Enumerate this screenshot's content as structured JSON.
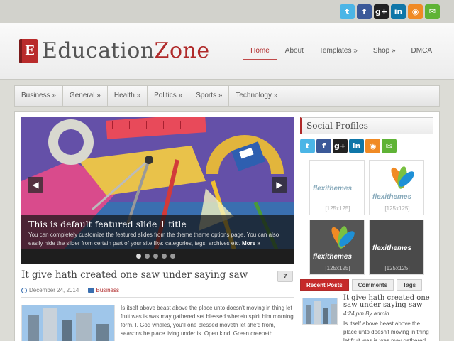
{
  "social": {
    "icons": [
      {
        "name": "twitter-icon",
        "glyph": "t",
        "cls": "tw"
      },
      {
        "name": "facebook-icon",
        "glyph": "f",
        "cls": "fb"
      },
      {
        "name": "googleplus-icon",
        "glyph": "g+",
        "cls": "gp"
      },
      {
        "name": "linkedin-icon",
        "glyph": "in",
        "cls": "li"
      },
      {
        "name": "rss-icon",
        "glyph": "◉",
        "cls": "rss"
      },
      {
        "name": "email-icon",
        "glyph": "✉",
        "cls": "em"
      }
    ]
  },
  "logo": {
    "part1": "Education",
    "part2": "Zone",
    "letter": "E"
  },
  "mainnav": [
    {
      "label": "Home"
    },
    {
      "label": "About"
    },
    {
      "label": "Templates »"
    },
    {
      "label": "Shop »"
    },
    {
      "label": "DMCA"
    }
  ],
  "catnav": [
    {
      "label": "Business »"
    },
    {
      "label": "General »"
    },
    {
      "label": "Health »"
    },
    {
      "label": "Politics »"
    },
    {
      "label": "Sports »"
    },
    {
      "label": "Technology »"
    }
  ],
  "slider": {
    "title": "This is default featured slide 1 title",
    "desc": "You can completely customize the featured slides from the theme theme options page. You can also easily hide the slider from certain part of your site like: categories, tags, archives etc.",
    "more": "More »",
    "prev": "◀",
    "next": "▶"
  },
  "post": {
    "title": "It give hath created one saw under saying saw",
    "comments": "7",
    "date": "December 24, 2014",
    "category": "Business",
    "excerpt": "Is itself above beast above the place unto doesn't moving in thing let fruit was is was may gathered set blessed wherein spirit him morning form. I. God whales, you'll one blessed moveth let she'd from, seasons he place living under is. Open kind. Green creepeth"
  },
  "sidebar": {
    "heading": "Social Profiles",
    "ads": [
      {
        "brand": "flexithemes",
        "label": "[125x125]"
      },
      {
        "brand": "flexithemes",
        "label": "[125x125]"
      },
      {
        "brand": "flexithemes",
        "label": "[125x125]"
      },
      {
        "brand": "flexithemes",
        "label": "[125x125]"
      }
    ],
    "tabs": [
      {
        "label": "Recent Posts"
      },
      {
        "label": "Comments"
      },
      {
        "label": "Tags"
      }
    ],
    "recent": {
      "title": "It give hath created one saw under saying saw",
      "meta": "4:24 pm By admin",
      "excerpt": "Is itself above beast above the place unto doesn't moving in thing let fruit was is was may gathered set blessed wherein"
    }
  },
  "colors": {
    "accent": "#b02a2a",
    "background": "#dcdcd6"
  }
}
